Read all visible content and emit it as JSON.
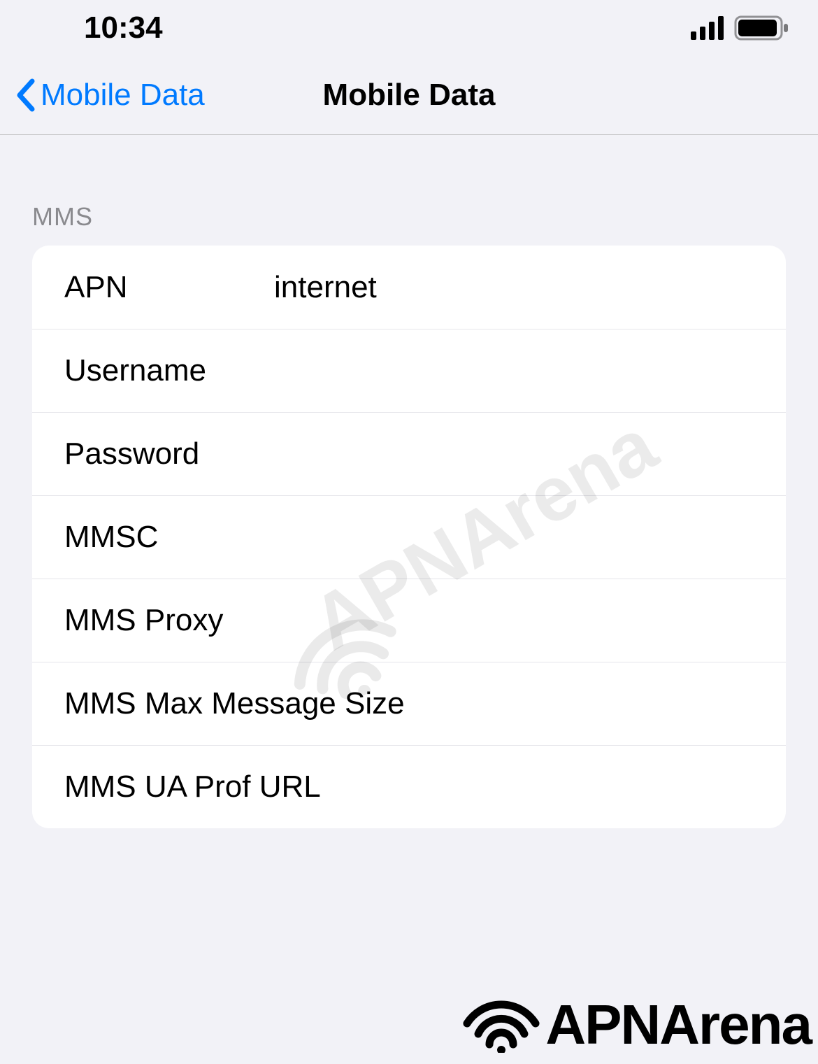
{
  "status_bar": {
    "time": "10:34"
  },
  "nav": {
    "back_label": "Mobile Data",
    "title": "Mobile Data"
  },
  "section": {
    "header": "MMS",
    "rows": [
      {
        "label": "APN",
        "value": "internet"
      },
      {
        "label": "Username",
        "value": ""
      },
      {
        "label": "Password",
        "value": ""
      },
      {
        "label": "MMSC",
        "value": ""
      },
      {
        "label": "MMS Proxy",
        "value": ""
      },
      {
        "label": "MMS Max Message Size",
        "value": ""
      },
      {
        "label": "MMS UA Prof URL",
        "value": ""
      }
    ]
  },
  "watermark": "APNArena",
  "footer_brand": "APNArena"
}
